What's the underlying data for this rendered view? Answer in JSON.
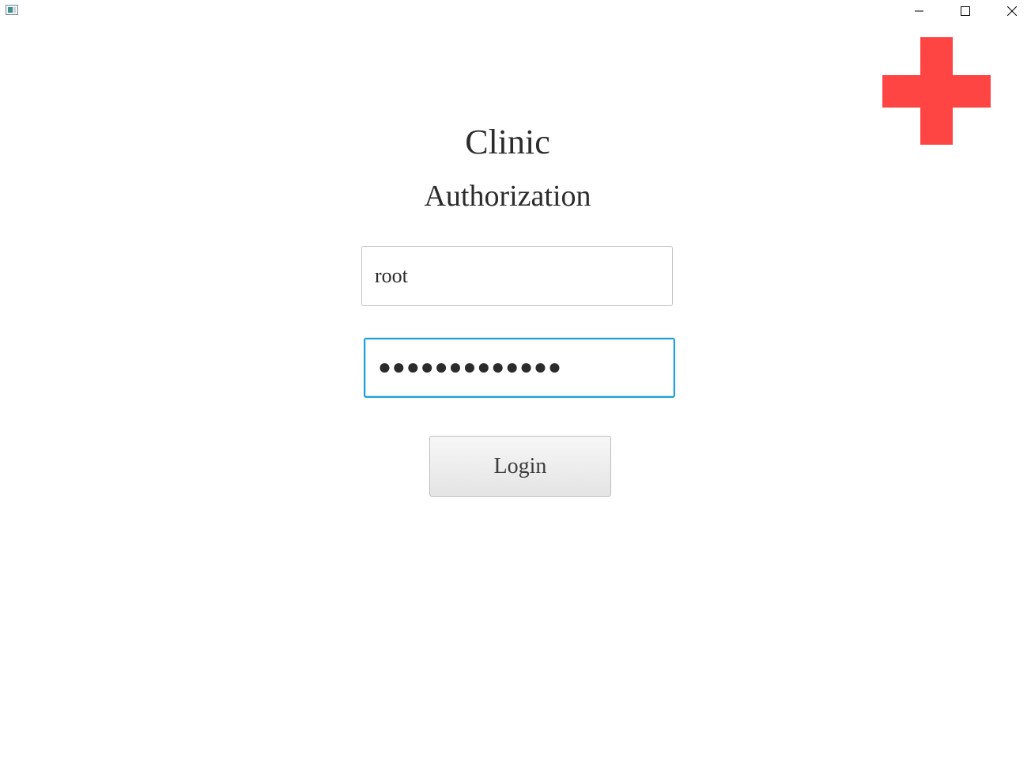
{
  "window": {
    "controls": {
      "minimize_icon": "minimize-icon",
      "maximize_icon": "maximize-icon",
      "close_icon": "close-icon"
    }
  },
  "logo": {
    "icon": "red-cross-icon",
    "color": "#ff4444"
  },
  "heading": {
    "title": "Clinic",
    "subtitle": "Authorization"
  },
  "form": {
    "username_value": "root",
    "password_value": "●●●●●●●●●●●●●",
    "login_label": "Login"
  },
  "colors": {
    "focus_border": "#1ea0d8",
    "text": "#2b2b2b"
  }
}
